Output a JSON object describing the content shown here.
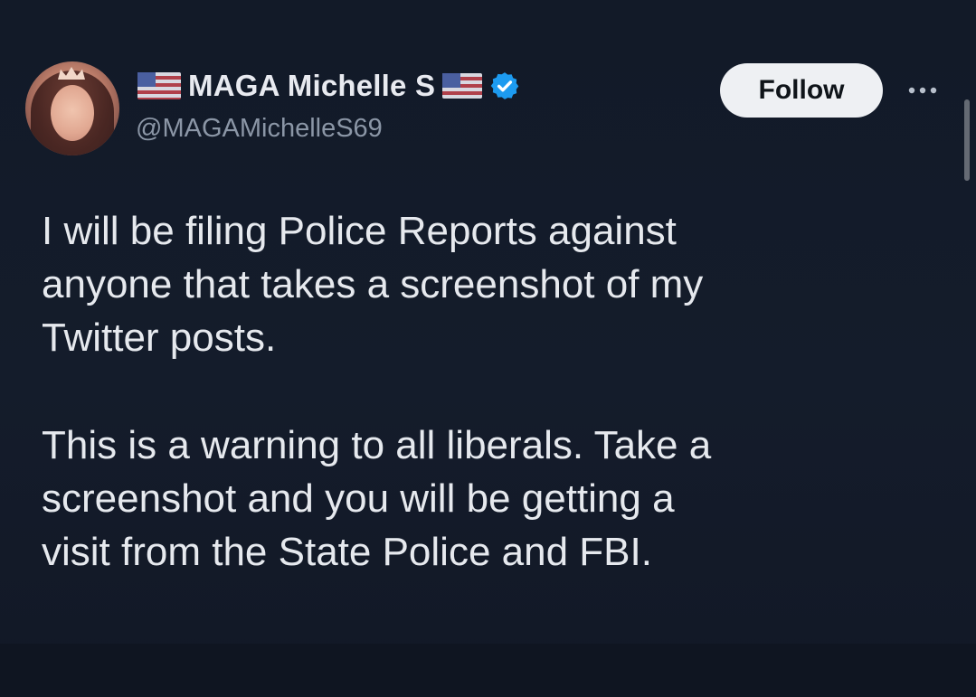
{
  "post": {
    "author": {
      "display_name": "MAGA Michelle S",
      "handle": "@MAGAMichelleS69",
      "verified": true,
      "name_emoji": "us-flag-icon",
      "avatar_icon": "avatar-photo"
    },
    "follow_label": "Follow",
    "more_icon": "more-options-icon",
    "text": {
      "paragraph_1": [
        "I will be filing Police Reports against",
        "anyone that takes a screenshot of my",
        "Twitter posts."
      ],
      "paragraph_2": [
        "This is a warning to all liberals. Take a",
        "screenshot and you will be getting a",
        "visit from the State Police and FBI."
      ]
    }
  },
  "colors": {
    "background": "#141b29",
    "text_primary": "#e6e9ee",
    "text_secondary": "#8b96a6",
    "verified_badge": "#1d9bf0",
    "follow_button_bg": "#eef0f3"
  }
}
